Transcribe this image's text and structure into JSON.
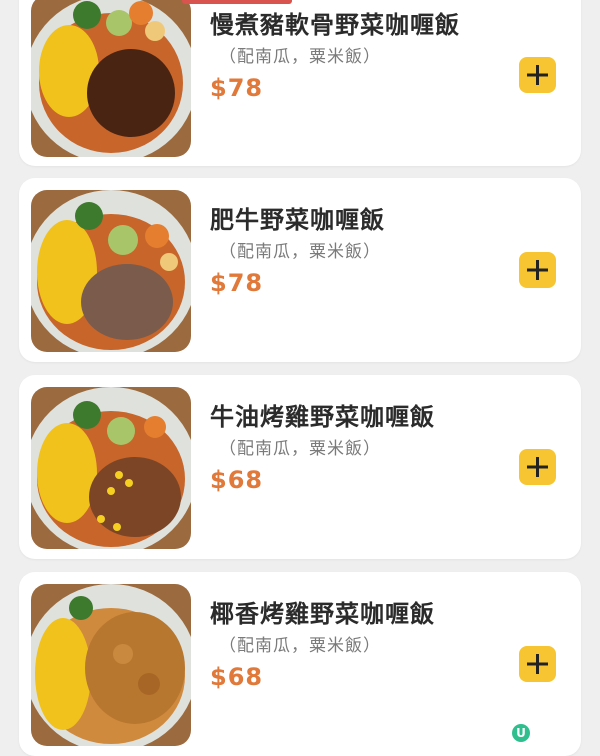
{
  "menu": {
    "items": [
      {
        "name": "慢煮豬軟骨野菜咖喱飯",
        "note": "（配南瓜，粟米飯）",
        "price": "$78",
        "meat_color": "#4a2412"
      },
      {
        "name": "肥牛野菜咖喱飯",
        "note": "（配南瓜，粟米飯）",
        "price": "$78",
        "meat_color": "#7a5b4c"
      },
      {
        "name": "牛油烤雞野菜咖喱飯",
        "note": "（配南瓜，粟米飯）",
        "price": "$68",
        "meat_color": "#7b4526"
      },
      {
        "name": "椰香烤雞野菜咖喱飯",
        "note": "（配南瓜，粟米飯）",
        "price": "$68",
        "meat_color": "#b8772e"
      }
    ]
  },
  "colors": {
    "accent": "#f7c531",
    "price": "#e0793a",
    "card_background": "#ffffff",
    "page_background": "#efefef"
  },
  "icons": {
    "add": "plus-icon",
    "brand": "u-logo-icon"
  },
  "watermark": "U"
}
